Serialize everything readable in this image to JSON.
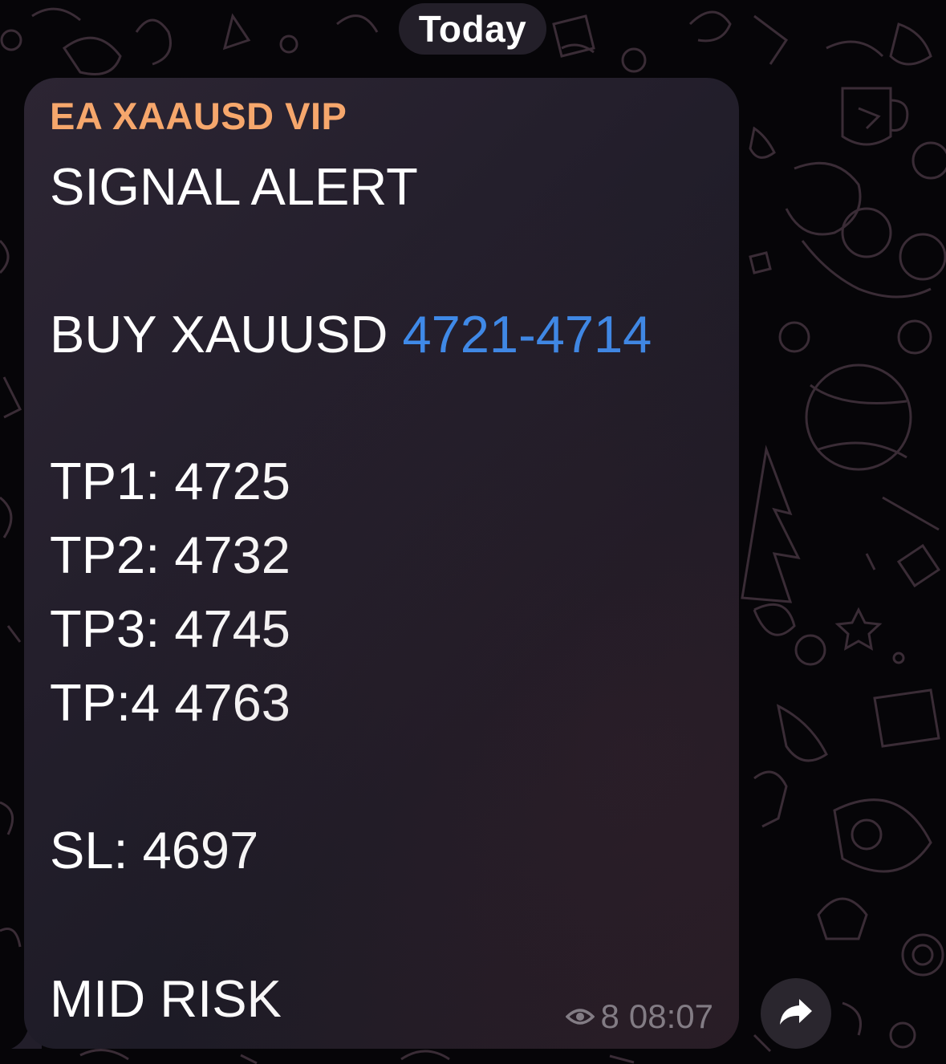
{
  "date_separator": "Today",
  "message": {
    "sender": "EA XAAUSD VIP",
    "title": "SIGNAL ALERT",
    "buy_prefix": "BUY XAUUSD ",
    "buy_range": "4721-4714",
    "tp1": "TP1: 4725",
    "tp2": "TP2: 4732",
    "tp3": "TP3: 4745",
    "tp4": "TP:4 4763",
    "stop_loss": "SL: 4697",
    "risk": "MID RISK",
    "views": "8",
    "time": "08:07"
  },
  "icons": {
    "views": "eye-icon",
    "share": "forward-arrow-icon"
  },
  "colors": {
    "sender_name": "#f6a76c",
    "link": "#3f8ef0",
    "meta": "#8c8a92"
  }
}
